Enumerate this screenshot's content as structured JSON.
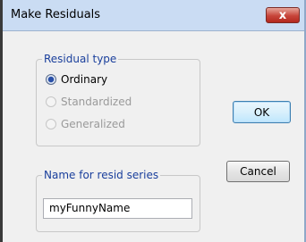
{
  "window": {
    "title": "Make Residuals",
    "close_glyph": "x"
  },
  "residual_type": {
    "legend": "Residual type",
    "options": [
      {
        "label": "Ordinary",
        "checked": true,
        "disabled": false
      },
      {
        "label": "Standardized",
        "checked": false,
        "disabled": true
      },
      {
        "label": "Generalized",
        "checked": false,
        "disabled": true
      }
    ]
  },
  "name_group": {
    "legend": "Name for resid series",
    "value": "myFunnyName"
  },
  "buttons": {
    "ok": "OK",
    "cancel": "Cancel"
  },
  "colors": {
    "background": "#f3d8dc",
    "titlebar": "#cadcf3",
    "group_legend": "#1a3f9c",
    "close_button": "#c7443a"
  }
}
